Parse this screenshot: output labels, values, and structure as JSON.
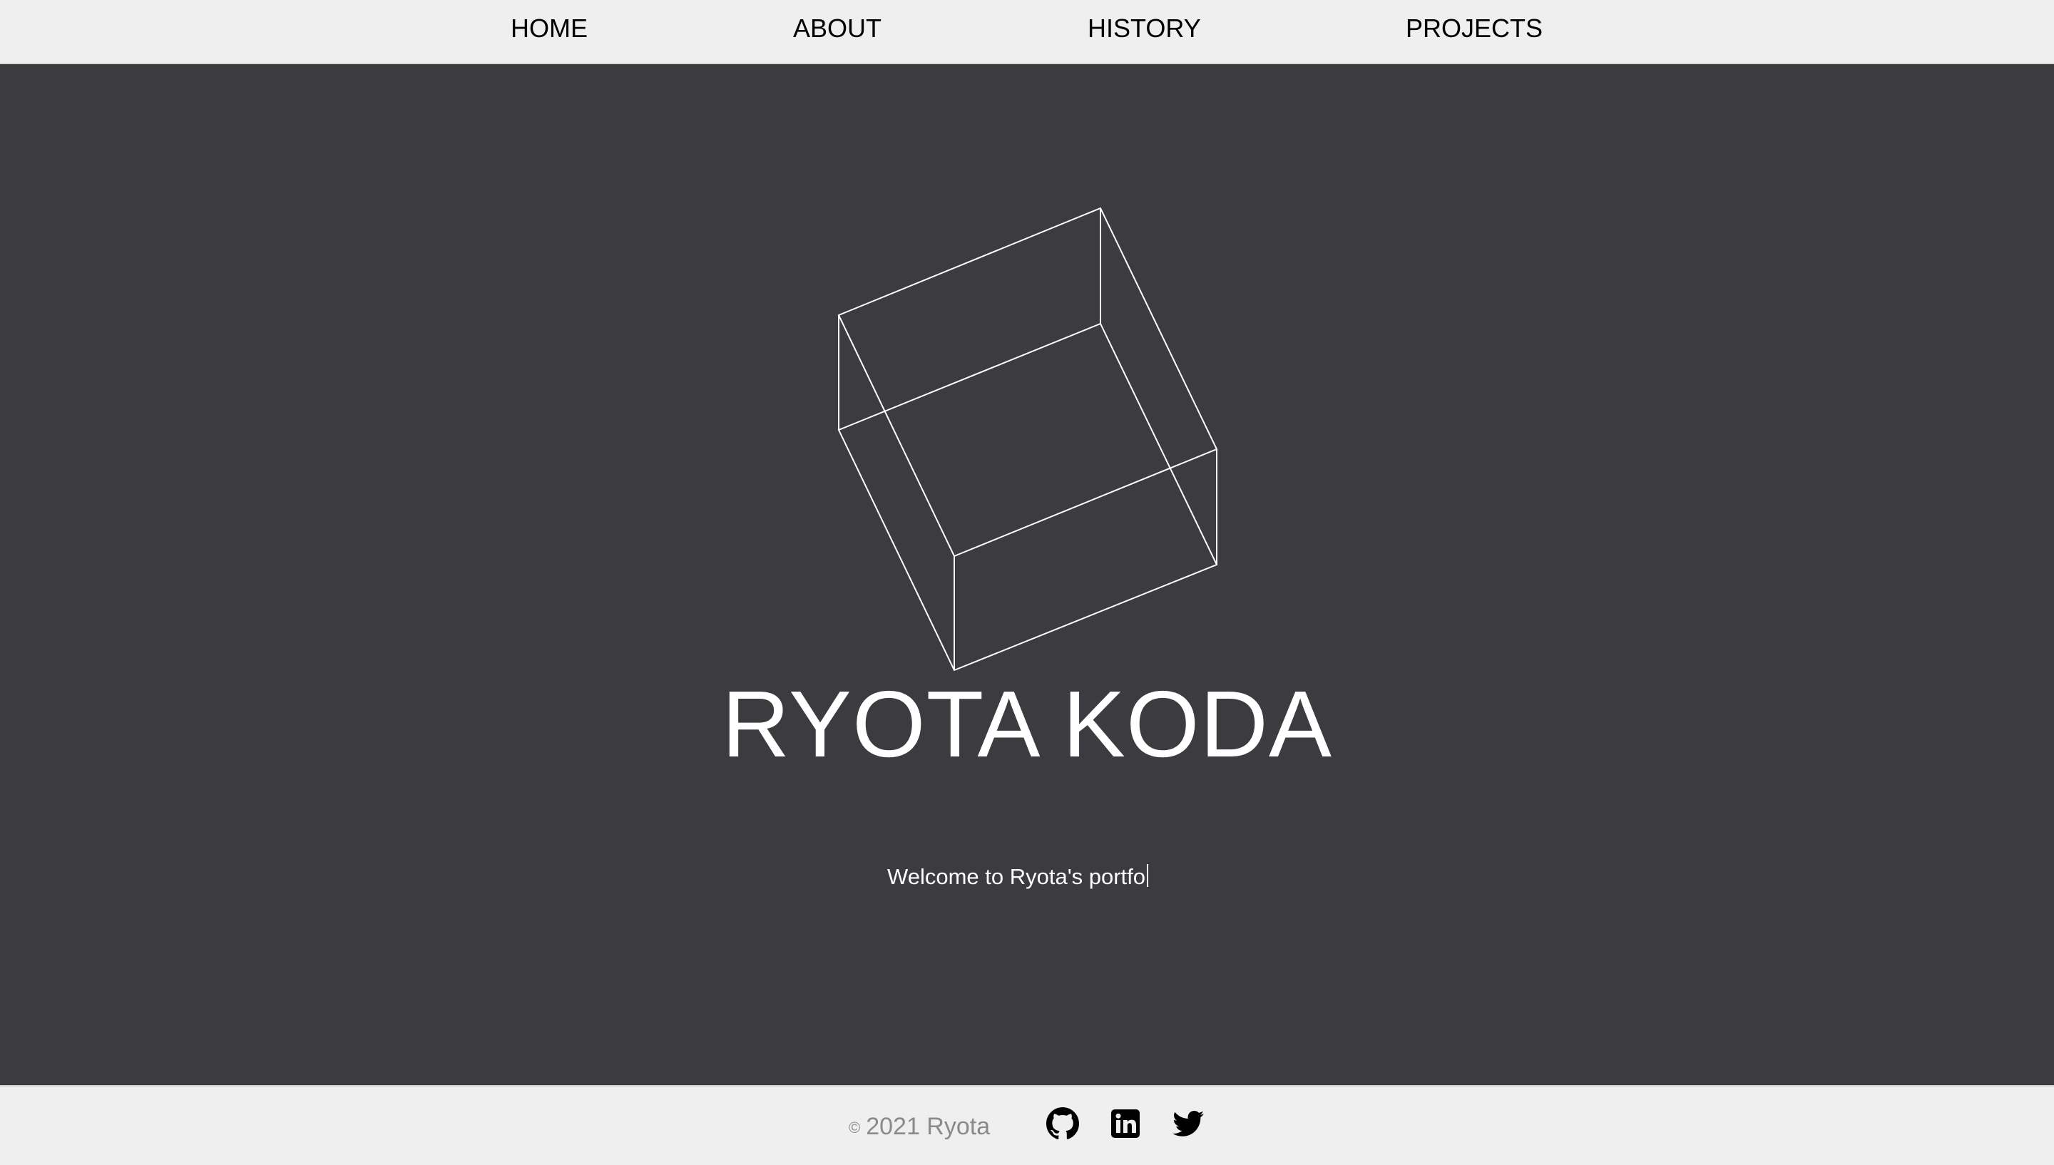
{
  "nav": {
    "items": [
      {
        "label": "HOME"
      },
      {
        "label": "ABOUT"
      },
      {
        "label": "HISTORY"
      },
      {
        "label": "PROJECTS"
      }
    ]
  },
  "hero": {
    "title": "RYOTA KODA",
    "subtitle": "Welcome to Ryota's portfo",
    "graphic": "wireframe-cube"
  },
  "footer": {
    "copyright_symbol": "©",
    "copyright_text": "2021 Ryota",
    "social": [
      {
        "icon": "github-icon"
      },
      {
        "icon": "linkedin-icon"
      },
      {
        "icon": "twitter-icon"
      }
    ]
  },
  "colors": {
    "background": "#3c3b40",
    "navbar": "#efefef",
    "footer": "#efefef",
    "text_light": "#ffffff",
    "copyright_text": "#8a8a8a"
  }
}
